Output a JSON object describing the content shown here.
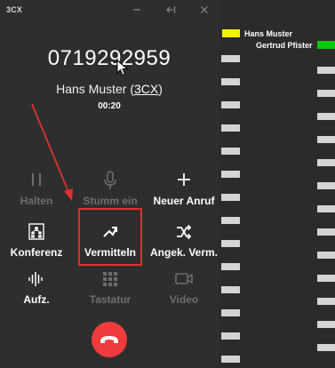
{
  "app": {
    "logo": "3CX"
  },
  "titlebar": {
    "minimize_icon": "minimize-icon",
    "collapse_icon": "collapse-left-icon",
    "close_icon": "close-icon"
  },
  "call": {
    "number": "0719292959",
    "contact_name": "Hans Muster",
    "contact_source": "3CX",
    "duration": "00:20"
  },
  "buttons": {
    "hold": {
      "label": "Halten",
      "icon": "pause-icon",
      "enabled": false
    },
    "mute": {
      "label": "Stumm ein",
      "icon": "microphone-icon",
      "enabled": false
    },
    "new_call": {
      "label": "Neuer Anruf",
      "icon": "plus-icon",
      "enabled": true
    },
    "conference": {
      "label": "Konferenz",
      "icon": "conference-icon",
      "enabled": true
    },
    "transfer": {
      "label": "Vermitteln",
      "icon": "transfer-icon",
      "enabled": true
    },
    "attended_transfer": {
      "label": "Angek. Verm.",
      "icon": "shuffle-icon",
      "enabled": true
    },
    "record": {
      "label": "Aufz.",
      "icon": "waveform-icon",
      "enabled": true
    },
    "keypad": {
      "label": "Tastatur",
      "icon": "keypad-icon",
      "enabled": false
    },
    "video": {
      "label": "Video",
      "icon": "video-icon",
      "enabled": false
    },
    "hangup": {
      "icon": "hangup-icon"
    }
  },
  "legend": [
    {
      "name": "Hans Muster",
      "color": "#f2f200"
    },
    {
      "name": "Gertrud Pfister",
      "color": "#00c800"
    }
  ],
  "colors": {
    "background": "#2e2e2e",
    "hangup": "#ef3b3b",
    "annotation": "#e0302a"
  }
}
